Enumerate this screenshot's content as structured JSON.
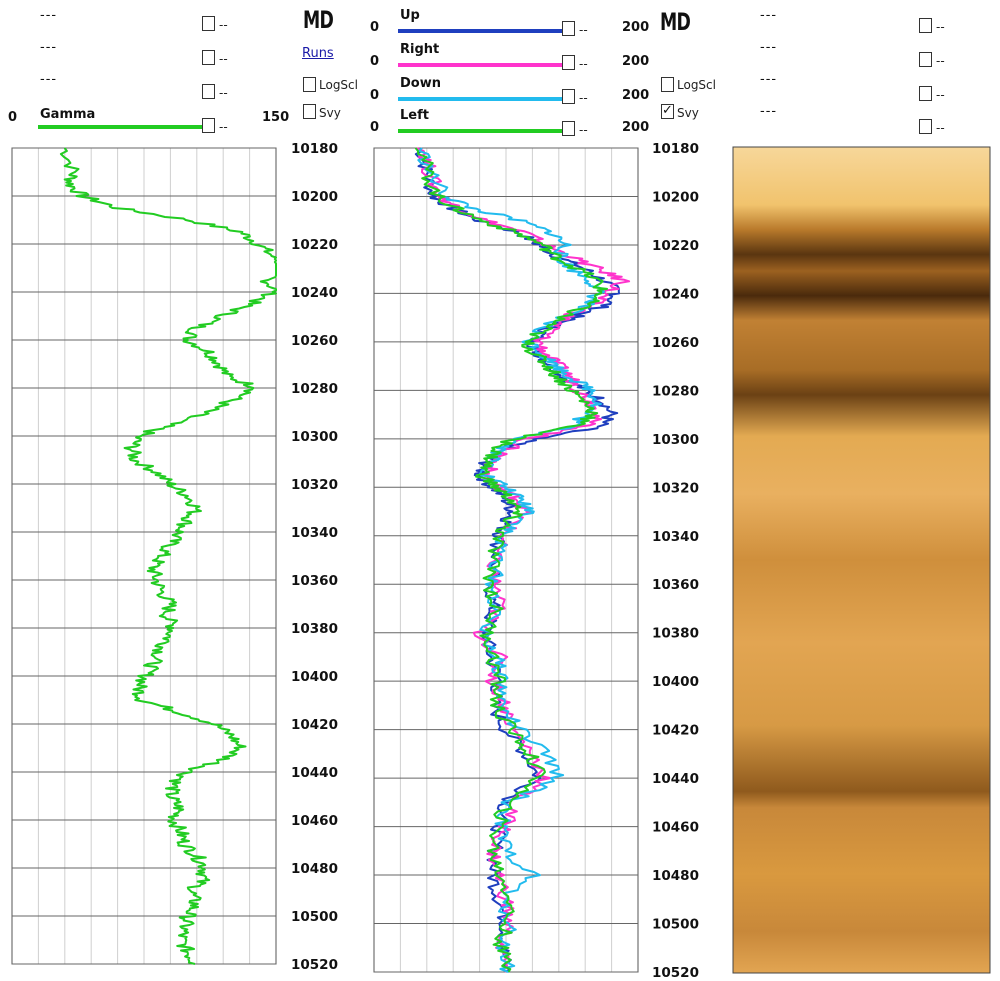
{
  "header_left": {
    "placeholders": [
      "---",
      "---",
      "---"
    ],
    "gamma": {
      "label": "Gamma",
      "min": "0",
      "max": "150",
      "color": "#22cc22"
    },
    "checkbox_suffix": "--"
  },
  "md_col_1": {
    "title": "MD",
    "runs_link": "Runs",
    "logscl_label": "LogScl",
    "svy_label": "Svy"
  },
  "header_mid": {
    "curves": [
      {
        "label": "Up",
        "min": "0",
        "max": "200",
        "color": "#1f3fbf"
      },
      {
        "label": "Right",
        "min": "0",
        "max": "200",
        "color": "#ff33cc"
      },
      {
        "label": "Down",
        "min": "0",
        "max": "200",
        "color": "#22bbee"
      },
      {
        "label": "Left",
        "min": "0",
        "max": "200",
        "color": "#22cc22"
      }
    ],
    "checkbox_suffix": "--"
  },
  "md_col_2": {
    "title": "MD",
    "logscl_label": "LogScl",
    "svy_label": "Svy",
    "svy_checked": true
  },
  "header_right": {
    "placeholders": [
      "---",
      "---",
      "---",
      "---"
    ],
    "checkbox_suffix": "--"
  },
  "chart_data": [
    {
      "type": "line",
      "name": "gamma-track",
      "ylim": [
        10180,
        10520
      ],
      "xlim": [
        0,
        150
      ],
      "yticks": [
        "10180",
        "10200",
        "10220",
        "10240",
        "10260",
        "10280",
        "10300",
        "10320",
        "10340",
        "10360",
        "10380",
        "10400",
        "10420",
        "10440",
        "10460",
        "10480",
        "10500",
        "10520"
      ],
      "series": [
        {
          "name": "Gamma",
          "color": "#22cc22",
          "depth": [
            10180,
            10190,
            10195,
            10200,
            10205,
            10210,
            10215,
            10220,
            10225,
            10230,
            10235,
            10240,
            10245,
            10250,
            10255,
            10260,
            10265,
            10270,
            10275,
            10280,
            10285,
            10290,
            10295,
            10300,
            10305,
            10310,
            10315,
            10320,
            10325,
            10330,
            10335,
            10340,
            10345,
            10350,
            10355,
            10360,
            10365,
            10370,
            10375,
            10380,
            10385,
            10390,
            10395,
            10400,
            10405,
            10410,
            10415,
            10420,
            10425,
            10430,
            10435,
            10440,
            10445,
            10450,
            10455,
            10460,
            10465,
            10470,
            10475,
            10480,
            10485,
            10490,
            10495,
            10500,
            10505,
            10510,
            10515,
            10520
          ],
          "values": [
            30,
            35,
            33,
            40,
            60,
            100,
            130,
            140,
            148,
            155,
            145,
            150,
            135,
            120,
            105,
            100,
            112,
            118,
            122,
            140,
            125,
            110,
            90,
            72,
            68,
            70,
            82,
            90,
            100,
            105,
            100,
            95,
            90,
            85,
            80,
            82,
            85,
            90,
            88,
            92,
            88,
            84,
            80,
            76,
            72,
            74,
            95,
            115,
            125,
            130,
            120,
            100,
            92,
            90,
            95,
            92,
            96,
            98,
            105,
            110,
            108,
            102,
            104,
            100,
            98,
            96,
            100,
            104
          ]
        }
      ]
    },
    {
      "type": "line",
      "name": "caliper-track",
      "ylim": [
        10180,
        10520
      ],
      "xlim": [
        0,
        200
      ],
      "yticks": [
        "10180",
        "10200",
        "10220",
        "10240",
        "10260",
        "10280",
        "10300",
        "10320",
        "10340",
        "10360",
        "10380",
        "10400",
        "10420",
        "10440",
        "10460",
        "10480",
        "10500",
        "10520"
      ],
      "series": [
        {
          "name": "Up",
          "color": "#1f3fbf",
          "depth": [
            10180,
            10190,
            10200,
            10205,
            10210,
            10215,
            10220,
            10225,
            10230,
            10235,
            10240,
            10245,
            10250,
            10255,
            10260,
            10265,
            10270,
            10275,
            10280,
            10285,
            10290,
            10295,
            10300,
            10305,
            10310,
            10315,
            10320,
            10325,
            10330,
            10335,
            10340,
            10350,
            10360,
            10370,
            10380,
            10390,
            10400,
            10410,
            10420,
            10430,
            10440,
            10450,
            10460,
            10470,
            10480,
            10490,
            10500,
            10510,
            10520
          ],
          "values": [
            35,
            40,
            45,
            60,
            80,
            110,
            125,
            140,
            160,
            175,
            185,
            175,
            150,
            130,
            120,
            125,
            135,
            145,
            160,
            175,
            180,
            170,
            120,
            95,
            85,
            80,
            90,
            100,
            105,
            100,
            95,
            92,
            88,
            90,
            85,
            88,
            95,
            90,
            100,
            115,
            125,
            100,
            95,
            92,
            90,
            95,
            100,
            98,
            100
          ]
        },
        {
          "name": "Right",
          "color": "#ff33cc",
          "depth": [
            10180,
            10190,
            10200,
            10205,
            10210,
            10215,
            10220,
            10225,
            10230,
            10235,
            10240,
            10245,
            10250,
            10255,
            10260,
            10265,
            10270,
            10275,
            10280,
            10285,
            10290,
            10295,
            10300,
            10305,
            10310,
            10315,
            10320,
            10325,
            10330,
            10335,
            10340,
            10350,
            10360,
            10370,
            10380,
            10390,
            10400,
            10410,
            10420,
            10430,
            10440,
            10450,
            10460,
            10470,
            10480,
            10490,
            10500,
            10510,
            10520
          ],
          "values": [
            38,
            42,
            50,
            65,
            85,
            115,
            130,
            150,
            170,
            190,
            175,
            165,
            145,
            135,
            125,
            130,
            140,
            150,
            155,
            165,
            170,
            160,
            115,
            100,
            90,
            85,
            95,
            110,
            115,
            105,
            98,
            90,
            92,
            95,
            80,
            95,
            90,
            100,
            105,
            120,
            130,
            105,
            100,
            90,
            95,
            100,
            102,
            96,
            100
          ]
        },
        {
          "name": "Down",
          "color": "#22bbee",
          "depth": [
            10180,
            10190,
            10200,
            10205,
            10210,
            10215,
            10220,
            10225,
            10230,
            10235,
            10240,
            10245,
            10250,
            10255,
            10260,
            10265,
            10270,
            10275,
            10280,
            10285,
            10290,
            10295,
            10300,
            10305,
            10310,
            10315,
            10320,
            10325,
            10330,
            10335,
            10340,
            10350,
            10360,
            10370,
            10380,
            10390,
            10400,
            10410,
            10420,
            10430,
            10440,
            10450,
            10460,
            10470,
            10480,
            10490,
            10500,
            10510,
            10520
          ],
          "values": [
            36,
            42,
            55,
            75,
            110,
            135,
            145,
            140,
            150,
            165,
            170,
            160,
            140,
            125,
            118,
            128,
            138,
            150,
            165,
            170,
            160,
            150,
            110,
            95,
            88,
            85,
            100,
            110,
            120,
            108,
            96,
            94,
            90,
            92,
            84,
            92,
            98,
            96,
            110,
            130,
            140,
            102,
            96,
            100,
            120,
            96,
            104,
            98,
            102
          ]
        },
        {
          "name": "Left",
          "color": "#22cc22",
          "depth": [
            10180,
            10190,
            10200,
            10205,
            10210,
            10215,
            10220,
            10225,
            10230,
            10235,
            10240,
            10245,
            10250,
            10255,
            10260,
            10265,
            10270,
            10275,
            10280,
            10285,
            10290,
            10295,
            10300,
            10305,
            10310,
            10315,
            10320,
            10325,
            10330,
            10335,
            10340,
            10350,
            10360,
            10370,
            10380,
            10390,
            10400,
            10410,
            10420,
            10430,
            10440,
            10450,
            10460,
            10470,
            10480,
            10490,
            10500,
            10510,
            10520
          ],
          "values": [
            37,
            40,
            48,
            62,
            82,
            108,
            128,
            138,
            155,
            170,
            172,
            160,
            142,
            128,
            115,
            122,
            132,
            140,
            150,
            160,
            168,
            150,
            105,
            92,
            86,
            82,
            92,
            104,
            108,
            100,
            94,
            90,
            88,
            92,
            86,
            90,
            94,
            92,
            104,
            118,
            126,
            100,
            94,
            90,
            96,
            104,
            100,
            96,
            102
          ]
        }
      ]
    }
  ]
}
